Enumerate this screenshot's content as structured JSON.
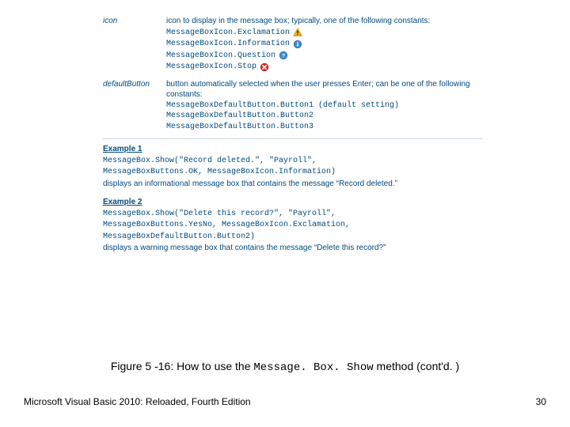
{
  "table": {
    "rows": [
      {
        "label": "icon",
        "desc": "icon to display in the message box; typically, one of the following constants:",
        "lines": [
          {
            "code": "MessageBoxIcon.Exclamation",
            "icon": "warning"
          },
          {
            "code": "MessageBoxIcon.Information",
            "icon": "info"
          },
          {
            "code": "MessageBoxIcon.Question",
            "icon": "question"
          },
          {
            "code": "MessageBoxIcon.Stop",
            "icon": "stop"
          }
        ]
      },
      {
        "label": "defaultButton",
        "desc": "button automatically selected when the user presses Enter; can be one of the following constants:",
        "lines": [
          {
            "code": "MessageBoxDefaultButton.Button1 (default setting)"
          },
          {
            "code": "MessageBoxDefaultButton.Button2"
          },
          {
            "code": "MessageBoxDefaultButton.Button3"
          }
        ]
      }
    ]
  },
  "examples": [
    {
      "head": "Example 1",
      "code": [
        "MessageBox.Show(\"Record deleted.\", \"Payroll\",",
        "    MessageBoxButtons.OK, MessageBoxIcon.Information)"
      ],
      "desc": "displays an informational message box that contains the message “Record deleted.”"
    },
    {
      "head": "Example 2",
      "code": [
        "MessageBox.Show(\"Delete this record?\", \"Payroll\",",
        "    MessageBoxButtons.YesNo, MessageBoxIcon.Exclamation,",
        "    MessageBoxDefaultButton.Button2)"
      ],
      "desc": "displays a warning message box that contains the message “Delete this record?”"
    }
  ],
  "caption": {
    "prefix": "Figure 5 -16: How to use the ",
    "code": "Message. Box. Show",
    "suffix": " method (cont'd. )"
  },
  "footer": {
    "left": "Microsoft Visual Basic 2010: Reloaded, Fourth Edition",
    "right": "30"
  }
}
